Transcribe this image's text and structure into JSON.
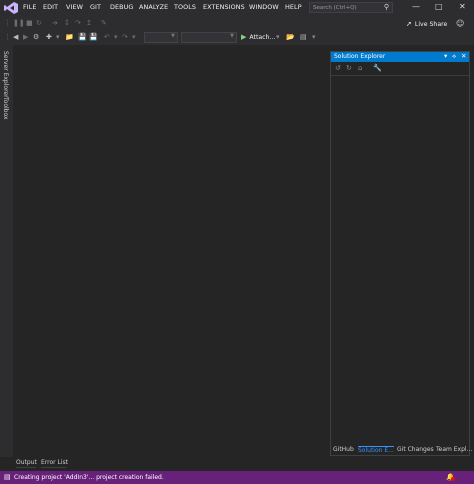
{
  "menu": [
    "FILE",
    "EDIT",
    "VIEW",
    "GIT",
    "DEBUG",
    "ANALYZE",
    "TOOLS",
    "EXTENSIONS",
    "WINDOW",
    "HELP"
  ],
  "search": {
    "placeholder": "Search (Ctrl+Q)"
  },
  "live_share": "Live Share",
  "toolbar": {
    "attach_label": "Attach..."
  },
  "left_tabs": [
    "Server Explorer",
    "Toolbox"
  ],
  "solution_explorer": {
    "title": "Solution Explorer",
    "tabs": [
      "GitHub",
      "Solution E...",
      "Git Changes",
      "Team Expl..."
    ]
  },
  "bottom_tabs": [
    "Output",
    "Error List"
  ],
  "status": {
    "message": "Creating project 'AddIn3'... project creation failed."
  },
  "colors": {
    "accent": "#007acc",
    "statusbar": "#68217a",
    "background": "#252526",
    "chrome": "#2d2d30"
  }
}
